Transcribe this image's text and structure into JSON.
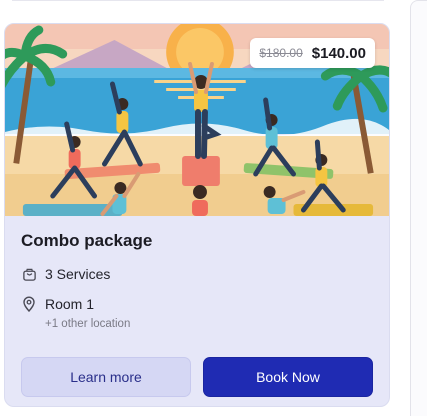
{
  "card": {
    "title": "Combo package",
    "price": {
      "original": "$180.00",
      "current": "$140.00"
    },
    "services": "3 Services",
    "location": "Room 1",
    "other_locations": "+1 other location",
    "buttons": {
      "learn_more": "Learn more",
      "book_now": "Book Now"
    }
  },
  "icons": {
    "services": "bag-icon",
    "location": "map-pin-icon"
  },
  "colors": {
    "primary": "#1f2bb3",
    "secondary_bg": "#d5d7f4",
    "card_bg": "#e6e7f8"
  }
}
